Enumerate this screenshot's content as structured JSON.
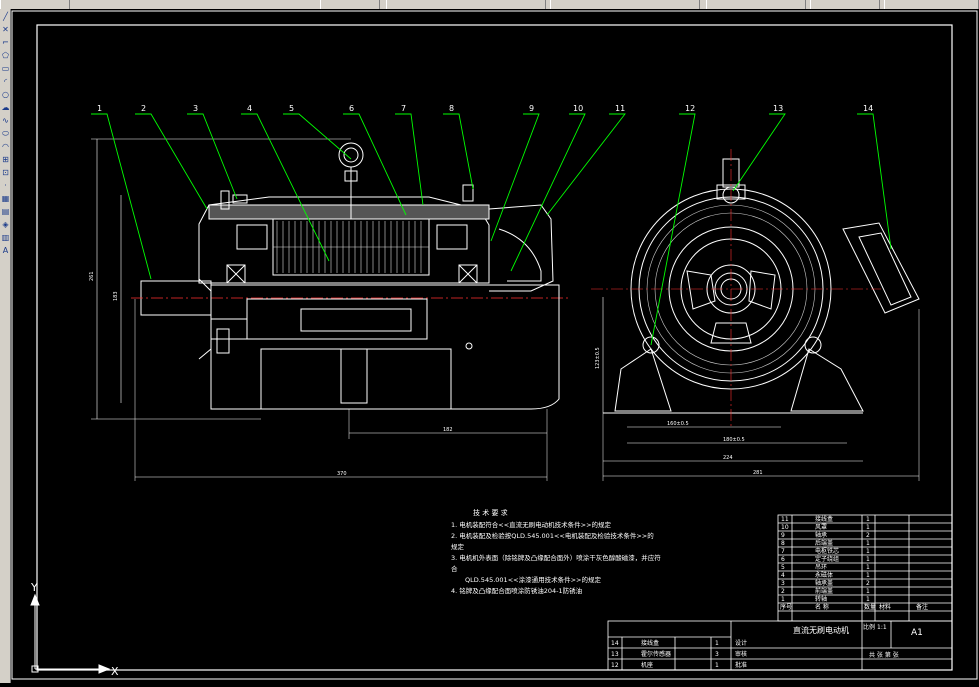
{
  "topbar": {
    "segments": [
      "",
      "",
      "",
      "",
      "",
      "",
      ""
    ]
  },
  "toolbar": {
    "tools": [
      {
        "icon": "line-tool-icon"
      },
      {
        "icon": "construction-line-icon"
      },
      {
        "icon": "polyline-icon"
      },
      {
        "icon": "polygon-icon"
      },
      {
        "icon": "rectangle-icon"
      },
      {
        "icon": "arc-icon"
      },
      {
        "icon": "circle-icon"
      },
      {
        "icon": "revcloud-icon"
      },
      {
        "icon": "spline-icon"
      },
      {
        "icon": "ellipse-icon"
      },
      {
        "icon": "ellipse-arc-icon"
      },
      {
        "icon": "insert-block-icon"
      },
      {
        "icon": "make-block-icon"
      },
      {
        "icon": "point-icon"
      },
      {
        "icon": "hatch-icon"
      },
      {
        "icon": "gradient-icon"
      },
      {
        "icon": "region-icon"
      },
      {
        "icon": "table-icon"
      },
      {
        "icon": "mtext-icon"
      }
    ]
  },
  "drawing": {
    "balloons": [
      "1",
      "2",
      "3",
      "4",
      "5",
      "6",
      "7",
      "8",
      "9",
      "10",
      "11",
      "12",
      "13",
      "14"
    ],
    "dims": {
      "d_left_vert": "261",
      "d_left_vert2": "183",
      "d_bottom1": "182",
      "d_bottom2": "370",
      "d_right_vert": "123±0.5",
      "d_right_h1": "160±0.5",
      "d_right_h2": "180±0.5",
      "d_right_h3": "224",
      "d_right_h4": "281"
    },
    "notes": {
      "title": "技 术 要 求",
      "lines": [
        "1.  电机装配符合<<直流无刷电动机技术条件>>的规定",
        "2.  电机装配及检验按QLD.545.001<<电机装配及检验技术条件>>的",
        "规定",
        "3.  电机机外表面（除铭牌及凸缘配合面外）喷涂干灰色醇酸磁漆，并应符",
        "合",
        "QLD.545.001<<涂漆通用技术条件>>的规定",
        "4.  铭牌及凸缘配合面喷涂防锈油204-1防锈油"
      ]
    },
    "title_block": {
      "parts": [
        {
          "no": "11",
          "name": "接线盒",
          "qty": "1"
        },
        {
          "no": "10",
          "name": "风罩",
          "qty": "1"
        },
        {
          "no": "9",
          "name": "轴承",
          "qty": "2"
        },
        {
          "no": "8",
          "name": "后端盖",
          "qty": "1"
        },
        {
          "no": "7",
          "name": "电枢铁芯",
          "qty": "1"
        },
        {
          "no": "6",
          "name": "定子绕组",
          "qty": "1"
        },
        {
          "no": "5",
          "name": "吊环",
          "qty": "1"
        },
        {
          "no": "4",
          "name": "永磁体",
          "qty": "1"
        },
        {
          "no": "3",
          "name": "轴承盖",
          "qty": "2"
        },
        {
          "no": "2",
          "name": "前端盖",
          "qty": "1"
        },
        {
          "no": "1",
          "name": "转轴",
          "qty": "1"
        }
      ],
      "head_row": [
        "序号",
        "名  称",
        "数量",
        "材料",
        "备注"
      ],
      "drawing_name": "直流无刷电动机",
      "scale_label": "比例",
      "scale_value": "1:1",
      "sheet_size": "A1",
      "company": "共 张 第 张",
      "lower_parts": [
        {
          "no": "14",
          "name": "接线盒"
        },
        {
          "no": "13",
          "name": "霍尔传感器"
        },
        {
          "no": "12",
          "name": "机座"
        }
      ],
      "roles": [
        "设计",
        "审核",
        "批准"
      ],
      "qty_vals": [
        "1",
        "3",
        "1"
      ]
    },
    "ucs": {
      "x": "X",
      "y": "Y"
    }
  }
}
